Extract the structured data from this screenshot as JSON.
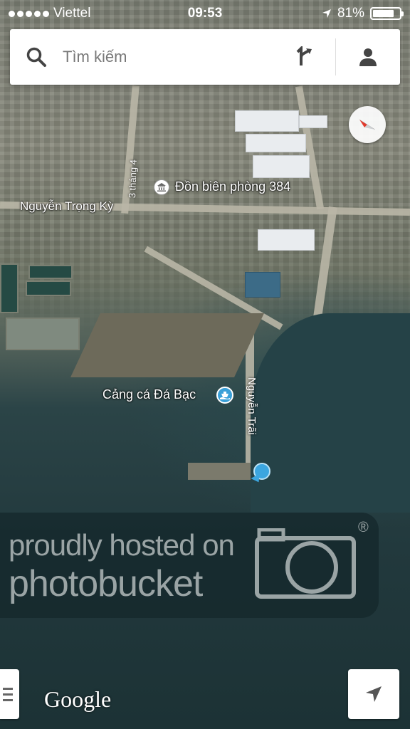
{
  "status_bar": {
    "carrier": "Viettel",
    "time": "09:53",
    "battery_percent": "81%",
    "battery_level": 0.81
  },
  "search": {
    "placeholder": "Tìm kiếm"
  },
  "map": {
    "labels": {
      "street_1": "Nguyễn Trọng Kỳ",
      "street_2": "3 tháng 4",
      "street_3": "Nguyễn Trãi",
      "poi_1": "Đồn biên phòng 384",
      "poi_2": "Cảng cá Đá Bạc"
    }
  },
  "watermark": {
    "line1": "proudly hosted on",
    "line2": "photobucket",
    "reg": "®"
  },
  "branding": {
    "google": "Google"
  },
  "colors": {
    "accent": "#3ca6e0",
    "water": "#254247"
  }
}
